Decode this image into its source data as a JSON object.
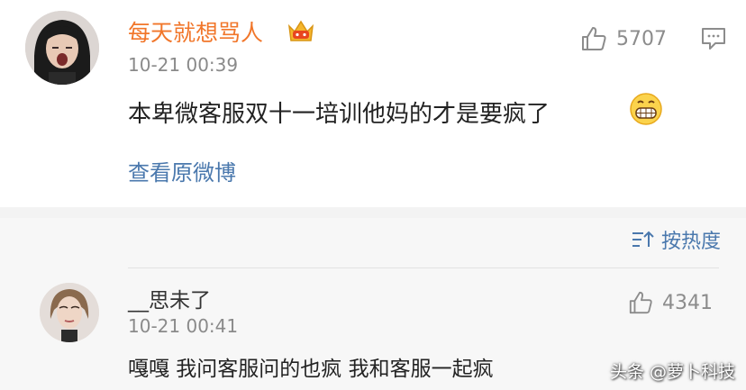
{
  "post": {
    "username": "每天就想骂人",
    "timestamp": "10-21 00:39",
    "like_count": "5707",
    "content": "本卑微客服双十一培训他妈的才是要疯了",
    "view_original_label": "查看原微博"
  },
  "sort": {
    "label": "按热度"
  },
  "comment": {
    "username": "__思未了",
    "timestamp": "10-21 00:41",
    "like_count": "4341",
    "content": "嘎嘎 我问客服问的也疯 我和客服一起疯"
  },
  "watermark": "头条 @萝卜科技",
  "colors": {
    "username_accent": "#f1762a",
    "link_blue": "#4a78ad",
    "meta_gray": "#8a8a8a",
    "section_bg": "#f7f7f7"
  },
  "icons": [
    "crown-badge-icon",
    "thumbs-up-icon",
    "comment-icon",
    "grin-emoji-icon",
    "sort-icon"
  ]
}
